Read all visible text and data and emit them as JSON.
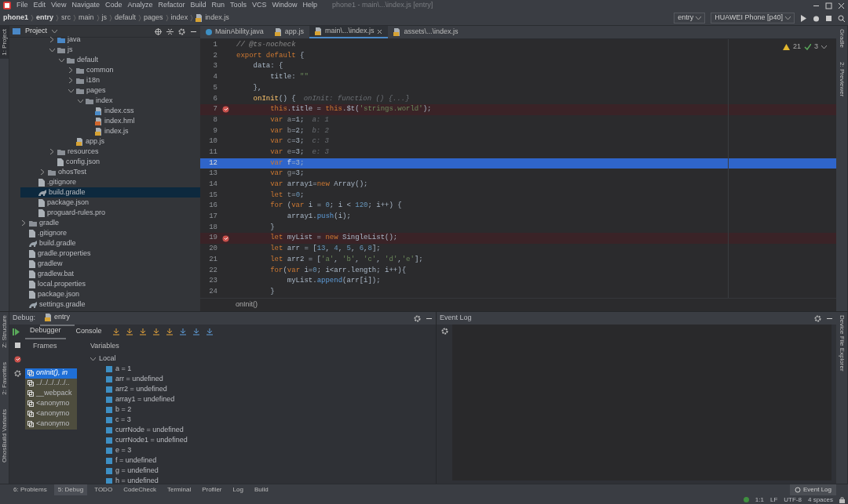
{
  "menu_bar": {
    "items": [
      "File",
      "Edit",
      "View",
      "Navigate",
      "Code",
      "Analyze",
      "Refactor",
      "Build",
      "Run",
      "Tools",
      "VCS",
      "Window",
      "Help"
    ],
    "title": "phone1 - main\\...\\index.js [entry]"
  },
  "nav_bar": {
    "breadcrumbs": [
      "phone1",
      "entry",
      "src",
      "main",
      "js",
      "default",
      "pages",
      "index",
      "index.js"
    ],
    "run_config": "entry",
    "device": "HUAWEI Phone [p40]"
  },
  "left_tool_windows": {
    "top": [
      {
        "label": "1: Project",
        "selected": true
      }
    ],
    "bottom": [
      {
        "label": "Z: Structure",
        "selected": false
      },
      {
        "label": "2: Favorites",
        "selected": false
      },
      {
        "label": "OhosBuild Variants",
        "selected": false
      }
    ]
  },
  "right_tool_windows": {
    "top": [
      {
        "label": "Gradle",
        "selected": false
      },
      {
        "label": "2: Previewer",
        "selected": false
      }
    ],
    "bottom": [
      {
        "label": "Device File Explorer",
        "selected": false
      }
    ]
  },
  "project_panel": {
    "title": "Project",
    "tree": [
      {
        "children": [
          {
            "children": [
              {
                "children": [
                  {
                    "label": "java",
                    "kind": "folder",
                    "expanded": false,
                    "selected": false
                  },
                  {
                    "label": "js",
                    "kind": "folder",
                    "expanded": true,
                    "selected": false,
                    "children": [
                      {
                        "label": "default",
                        "kind": "folder",
                        "expanded": true,
                        "selected": false,
                        "children": [
                          {
                            "label": "common",
                            "kind": "folder",
                            "expanded": false,
                            "selected": false
                          },
                          {
                            "label": "i18n",
                            "kind": "folder",
                            "expanded": false,
                            "selected": false
                          },
                          {
                            "label": "pages",
                            "kind": "folder",
                            "expanded": true,
                            "selected": false,
                            "children": [
                              {
                                "label": "index",
                                "kind": "folder",
                                "expanded": true,
                                "selected": false,
                                "children": [
                                  {
                                    "label": "index.css",
                                    "kind": "css",
                                    "selected": false
                                  },
                                  {
                                    "label": "index.hml",
                                    "kind": "hml",
                                    "selected": false
                                  },
                                  {
                                    "label": "index.js",
                                    "kind": "js",
                                    "selected": false
                                  }
                                ]
                              }
                            ]
                          },
                          {
                            "label": "app.js",
                            "kind": "js",
                            "selected": false
                          }
                        ]
                      }
                    ]
                  },
                  {
                    "label": "resources",
                    "kind": "folder",
                    "expanded": false,
                    "selected": false
                  },
                  {
                    "label": "config.json",
                    "kind": "plain",
                    "selected": false
                  }
                ]
              },
              {
                "label": "ohosTest",
                "kind": "folder",
                "expanded": false,
                "selected": false
              }
            ]
          },
          {
            "label": ".gitignore",
            "kind": "plain",
            "selected": false
          },
          {
            "label": "build.gradle",
            "kind": "gradle",
            "selected": true
          },
          {
            "label": "package.json",
            "kind": "plain",
            "selected": false
          },
          {
            "label": "proguard-rules.pro",
            "kind": "plain",
            "selected": false
          }
        ]
      },
      {
        "label": "gradle",
        "kind": "folder",
        "expanded": false,
        "selected": false
      },
      {
        "label": ".gitignore",
        "kind": "plain",
        "selected": false
      },
      {
        "label": "build.gradle",
        "kind": "gradle",
        "selected": false
      },
      {
        "label": "gradle.properties",
        "kind": "plain",
        "selected": false
      },
      {
        "label": "gradlew",
        "kind": "plain",
        "selected": false
      },
      {
        "label": "gradlew.bat",
        "kind": "plain",
        "selected": false
      },
      {
        "label": "local.properties",
        "kind": "plain",
        "selected": false
      },
      {
        "label": "package.json",
        "kind": "plain",
        "selected": false
      },
      {
        "label": "settings.gradle",
        "kind": "gradle",
        "selected": false
      }
    ]
  },
  "editor": {
    "tabs": [
      {
        "label": "MainAbility.java",
        "selected": false
      },
      {
        "label": "app.js",
        "selected": false
      },
      {
        "label": "main\\...\\index.js",
        "selected": true
      },
      {
        "label": "assets\\...\\index.js",
        "selected": false
      }
    ],
    "warnings": "21",
    "checks": "3",
    "lines": [
      {
        "number": "1",
        "code": [
          {
            "kind": "comment",
            "text": "// @ts-nocheck"
          }
        ],
        "breakpoint": false,
        "selected": false
      },
      {
        "number": "2",
        "code": [
          {
            "kind": "keyword",
            "text": "export default"
          },
          {
            "kind": "plain",
            "text": " {"
          }
        ],
        "breakpoint": false,
        "selected": false
      },
      {
        "number": "3",
        "code": [
          {
            "kind": "plain",
            "text": "    data: {"
          }
        ],
        "breakpoint": false,
        "selected": false
      },
      {
        "number": "4",
        "code": [
          {
            "kind": "plain",
            "text": "        title: "
          },
          {
            "kind": "string",
            "text": "\"\""
          }
        ],
        "breakpoint": false,
        "selected": false
      },
      {
        "number": "5",
        "code": [
          {
            "kind": "plain",
            "text": "    },"
          }
        ],
        "breakpoint": false,
        "selected": false
      },
      {
        "number": "6",
        "code": [
          {
            "kind": "function",
            "text": "    onInit"
          },
          {
            "kind": "plain",
            "text": "() {"
          }
        ],
        "hint": "onInit: function () {...}",
        "breakpoint": false,
        "selected": false
      },
      {
        "number": "7",
        "code": [
          {
            "kind": "keyword",
            "text": "        this"
          },
          {
            "kind": "plain",
            "text": ".title = "
          },
          {
            "kind": "keyword",
            "text": "this"
          },
          {
            "kind": "plain",
            "text": ".$t("
          },
          {
            "kind": "string",
            "text": "'strings.world'"
          },
          {
            "kind": "plain",
            "text": ");"
          }
        ],
        "breakpoint": true,
        "selected": false
      },
      {
        "number": "8",
        "code": [
          {
            "kind": "keyword",
            "text": "        var "
          },
          {
            "kind": "unused",
            "text": "a"
          },
          {
            "kind": "plain",
            "text": "=1;"
          }
        ],
        "hint": "a: 1",
        "breakpoint": false,
        "selected": false
      },
      {
        "number": "9",
        "code": [
          {
            "kind": "keyword",
            "text": "        var "
          },
          {
            "kind": "unused",
            "text": "b"
          },
          {
            "kind": "plain",
            "text": "=2;"
          }
        ],
        "hint": "b: 2",
        "breakpoint": false,
        "selected": false
      },
      {
        "number": "10",
        "code": [
          {
            "kind": "keyword",
            "text": "        var "
          },
          {
            "kind": "unused",
            "text": "c"
          },
          {
            "kind": "plain",
            "text": "=3;"
          }
        ],
        "hint": "c: 3",
        "breakpoint": false,
        "selected": false
      },
      {
        "number": "11",
        "code": [
          {
            "kind": "keyword",
            "text": "        var "
          },
          {
            "kind": "unused",
            "text": "e"
          },
          {
            "kind": "plain",
            "text": "=3;"
          }
        ],
        "hint": "e: 3",
        "breakpoint": false,
        "selected": false
      },
      {
        "number": "12",
        "code": [
          {
            "kind": "keyword",
            "text": "        var "
          },
          {
            "kind": "unused",
            "text": "f"
          },
          {
            "kind": "plain",
            "text": "=3;"
          }
        ],
        "breakpoint": false,
        "selected": true
      },
      {
        "number": "13",
        "code": [
          {
            "kind": "keyword",
            "text": "        var "
          },
          {
            "kind": "unused",
            "text": "g"
          },
          {
            "kind": "plain",
            "text": "=3;"
          }
        ],
        "breakpoint": false,
        "selected": false
      },
      {
        "number": "14",
        "code": [
          {
            "kind": "keyword",
            "text": "        var "
          },
          {
            "kind": "plain",
            "text": "array1="
          },
          {
            "kind": "keyword",
            "text": "new "
          },
          {
            "kind": "plain",
            "text": "Array();"
          }
        ],
        "breakpoint": false,
        "selected": false
      },
      {
        "number": "15",
        "code": [
          {
            "kind": "keyword",
            "text": "        let "
          },
          {
            "kind": "unused",
            "text": "t"
          },
          {
            "kind": "plain",
            "text": "="
          },
          {
            "kind": "number",
            "text": "0"
          },
          {
            "kind": "plain",
            "text": ";"
          }
        ],
        "breakpoint": false,
        "selected": false
      },
      {
        "number": "16",
        "code": [
          {
            "kind": "keyword",
            "text": "        for "
          },
          {
            "kind": "plain",
            "text": "("
          },
          {
            "kind": "keyword",
            "text": "var "
          },
          {
            "kind": "plain",
            "text": "i = "
          },
          {
            "kind": "number",
            "text": "0"
          },
          {
            "kind": "plain",
            "text": "; i < "
          },
          {
            "kind": "number",
            "text": "120"
          },
          {
            "kind": "plain",
            "text": "; i++) {"
          }
        ],
        "breakpoint": false,
        "selected": false
      },
      {
        "number": "17",
        "code": [
          {
            "kind": "plain",
            "text": "            array1."
          },
          {
            "kind": "method",
            "text": "push"
          },
          {
            "kind": "plain",
            "text": "(i);"
          }
        ],
        "breakpoint": false,
        "selected": false
      },
      {
        "number": "18",
        "code": [
          {
            "kind": "plain",
            "text": "        }"
          }
        ],
        "breakpoint": false,
        "selected": false
      },
      {
        "number": "19",
        "code": [
          {
            "kind": "keyword",
            "text": "        let "
          },
          {
            "kind": "plain",
            "text": "myList = "
          },
          {
            "kind": "keyword",
            "text": "new "
          },
          {
            "kind": "plain",
            "text": "SingleList();"
          }
        ],
        "breakpoint": true,
        "selected": false
      },
      {
        "number": "20",
        "code": [
          {
            "kind": "keyword",
            "text": "        let "
          },
          {
            "kind": "plain",
            "text": "arr = ["
          },
          {
            "kind": "number",
            "text": "13"
          },
          {
            "kind": "plain",
            "text": ", "
          },
          {
            "kind": "number",
            "text": "4"
          },
          {
            "kind": "plain",
            "text": ", "
          },
          {
            "kind": "number",
            "text": "5"
          },
          {
            "kind": "plain",
            "text": ", "
          },
          {
            "kind": "number",
            "text": "6"
          },
          {
            "kind": "plain",
            "text": ","
          },
          {
            "kind": "number",
            "text": "8"
          },
          {
            "kind": "plain",
            "text": "];"
          }
        ],
        "breakpoint": false,
        "selected": false
      },
      {
        "number": "21",
        "code": [
          {
            "kind": "keyword",
            "text": "        let "
          },
          {
            "kind": "plain",
            "text": "arr2 = ["
          },
          {
            "kind": "string",
            "text": "'a'"
          },
          {
            "kind": "plain",
            "text": ", "
          },
          {
            "kind": "string",
            "text": "'b'"
          },
          {
            "kind": "plain",
            "text": ", "
          },
          {
            "kind": "string",
            "text": "'c'"
          },
          {
            "kind": "plain",
            "text": ", "
          },
          {
            "kind": "string",
            "text": "'d'"
          },
          {
            "kind": "plain",
            "text": ","
          },
          {
            "kind": "string",
            "text": "'e'"
          },
          {
            "kind": "plain",
            "text": "];"
          }
        ],
        "breakpoint": false,
        "selected": false
      },
      {
        "number": "22",
        "code": [
          {
            "kind": "keyword",
            "text": "        for"
          },
          {
            "kind": "plain",
            "text": "("
          },
          {
            "kind": "keyword",
            "text": "var "
          },
          {
            "kind": "plain",
            "text": "i="
          },
          {
            "kind": "number",
            "text": "0"
          },
          {
            "kind": "plain",
            "text": "; i<arr.length; i++){"
          }
        ],
        "breakpoint": false,
        "selected": false
      },
      {
        "number": "23",
        "code": [
          {
            "kind": "plain",
            "text": "            myList."
          },
          {
            "kind": "method",
            "text": "append"
          },
          {
            "kind": "plain",
            "text": "(arr[i]);"
          }
        ],
        "breakpoint": false,
        "selected": false
      },
      {
        "number": "24",
        "code": [
          {
            "kind": "plain",
            "text": "        }"
          }
        ],
        "breakpoint": false,
        "selected": false
      }
    ],
    "breadcrumb": "onInit()"
  },
  "debug": {
    "title": "Debug:",
    "session": "entry",
    "tabs": [
      {
        "label": "Debugger",
        "selected": true
      },
      {
        "label": "Console",
        "selected": false
      }
    ],
    "frames_label": "Frames",
    "variables_label": "Variables",
    "frames": [
      {
        "label": "onInit(), in",
        "selected": true
      },
      {
        "label": "../../../../../..",
        "selected": false
      },
      {
        "label": "__webpack",
        "selected": false
      },
      {
        "label": "<anonymo",
        "selected": false
      },
      {
        "label": "<anonymo",
        "selected": false
      },
      {
        "label": "<anonymo",
        "selected": false
      }
    ],
    "scope": {
      "label": "Local",
      "expanded": true,
      "variables": [
        "a = 1",
        "arr = undefined",
        "arr2 = undefined",
        "array1 = undefined",
        "b = 2",
        "c = 3",
        "currNode = undefined",
        "currNode1 = undefined",
        "e = 3",
        "f = undefined",
        "g = undefined",
        "h = undefined"
      ]
    }
  },
  "event_log": {
    "title": "Event Log"
  },
  "tool_tabs": [
    {
      "label": "6: Problems",
      "selected": false
    },
    {
      "label": "5: Debug",
      "selected": true
    },
    {
      "label": "TODO",
      "selected": false
    },
    {
      "label": "CodeCheck",
      "selected": false
    },
    {
      "label": "Terminal",
      "selected": false
    },
    {
      "label": "Profiler",
      "selected": false
    },
    {
      "label": "Log",
      "selected": false
    },
    {
      "label": "Build",
      "selected": false
    }
  ],
  "event_log_button": "Event Log",
  "status_bar": [
    "1:1",
    "LF",
    "UTF-8",
    "4 spaces"
  ]
}
